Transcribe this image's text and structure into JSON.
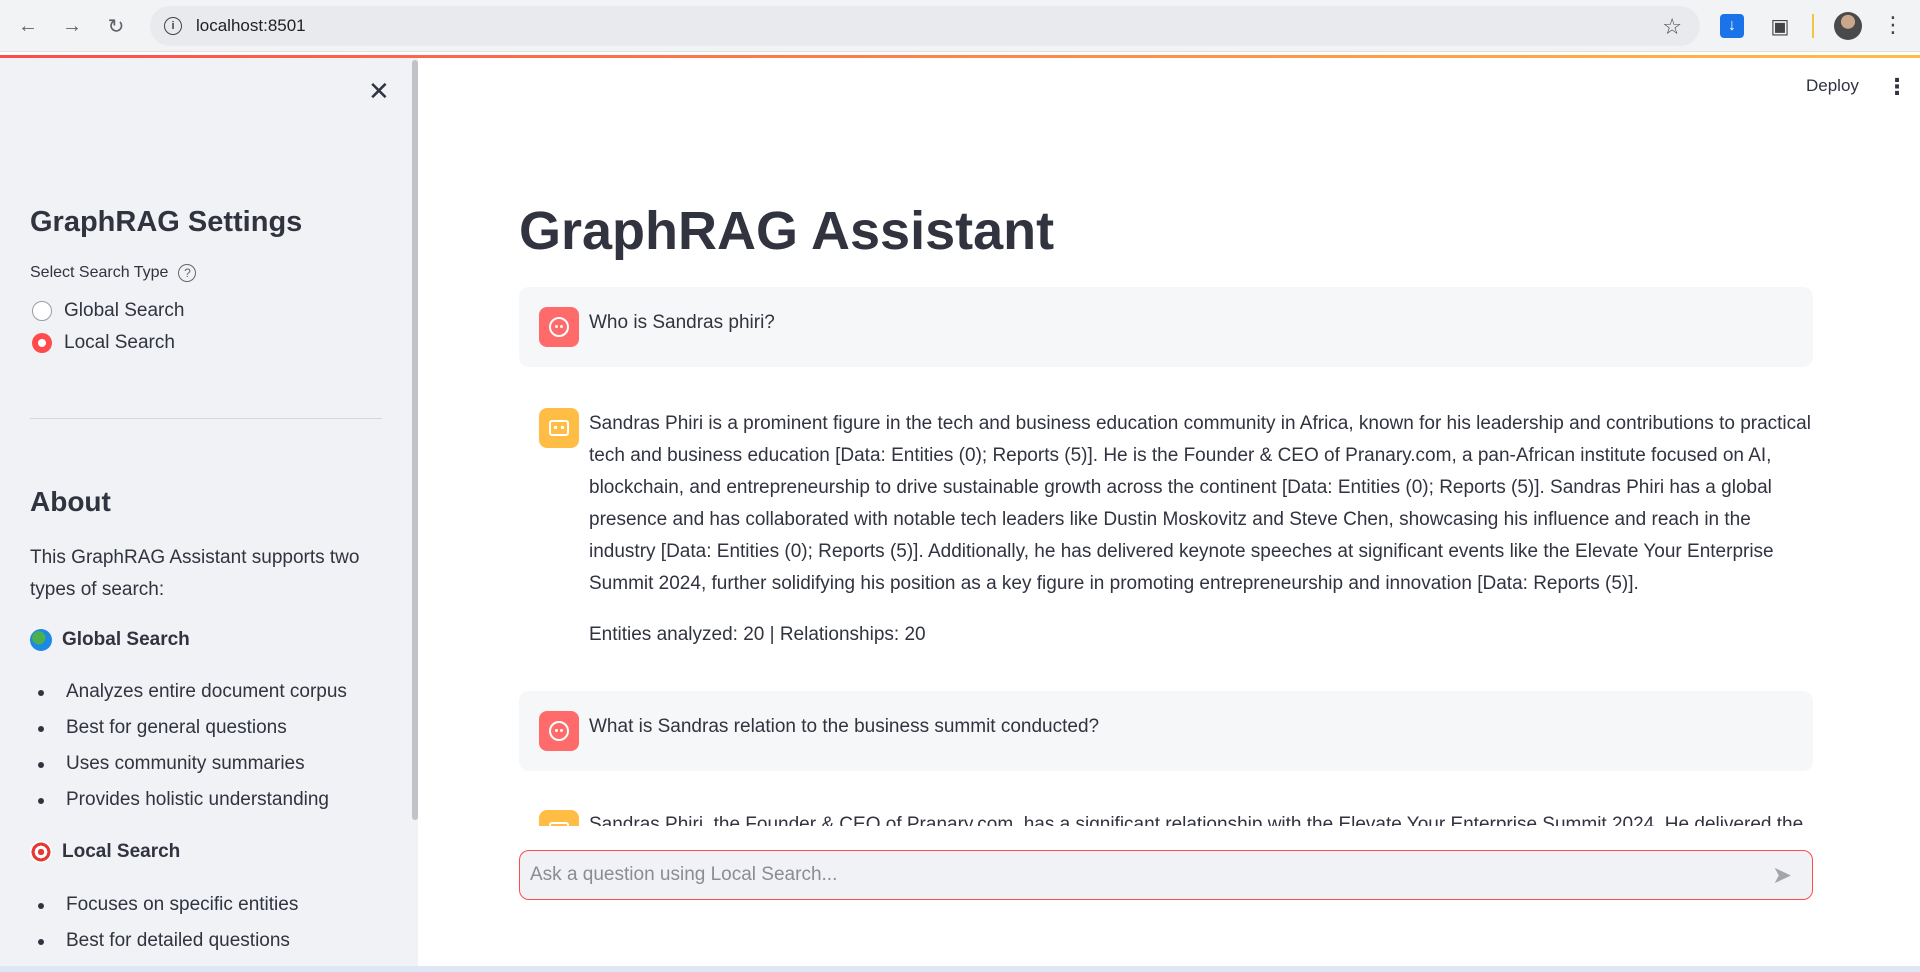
{
  "browser": {
    "url": "localhost:8501"
  },
  "sidebar": {
    "title": "GraphRAG Settings",
    "select_label": "Select Search Type",
    "options": [
      "Global Search",
      "Local Search"
    ],
    "selected": "Local Search",
    "about_title": "About",
    "about_text": "This GraphRAG Assistant supports two types of search:",
    "global": {
      "heading": "Global Search",
      "icon": "globe-icon",
      "bullets": [
        "Analyzes entire document corpus",
        "Best for general questions",
        "Uses community summaries",
        "Provides holistic understanding"
      ]
    },
    "local": {
      "heading": "Local Search",
      "icon": "target-icon",
      "bullets": [
        "Focuses on specific entities",
        "Best for detailed questions"
      ]
    }
  },
  "header": {
    "deploy_label": "Deploy"
  },
  "main": {
    "title": "GraphRAG Assistant",
    "messages": [
      {
        "role": "user",
        "text": "Who is Sandras phiri?"
      },
      {
        "role": "assistant",
        "text": "Sandras Phiri is a prominent figure in the tech and business education community in Africa, known for his leadership and contributions to practical tech and business education [Data: Entities (0); Reports (5)]. He is the Founder & CEO of Pranary.com, a pan-African institute focused on AI, blockchain, and entrepreneurship to drive sustainable growth across the continent [Data: Entities (0); Reports (5)]. Sandras Phiri has a global presence and has collaborated with notable tech leaders like Dustin Moskovitz and Steve Chen, showcasing his influence and reach in the industry [Data: Entities (0); Reports (5)]. Additionally, he has delivered keynote speeches at significant events like the Elevate Your Enterprise Summit 2024, further solidifying his position as a key figure in promoting entrepreneurship and innovation [Data: Reports (5)].",
        "stats": "Entities analyzed: 20 | Relationships: 20"
      },
      {
        "role": "user",
        "text": "What is Sandras relation to the business summit conducted?"
      },
      {
        "role": "assistant",
        "text": "Sandras Phiri, the Founder & CEO of Pranary.com, has a significant relationship with the Elevate Your Enterprise Summit 2024. He delivered the"
      }
    ],
    "input_placeholder": "Ask a question using Local Search..."
  }
}
